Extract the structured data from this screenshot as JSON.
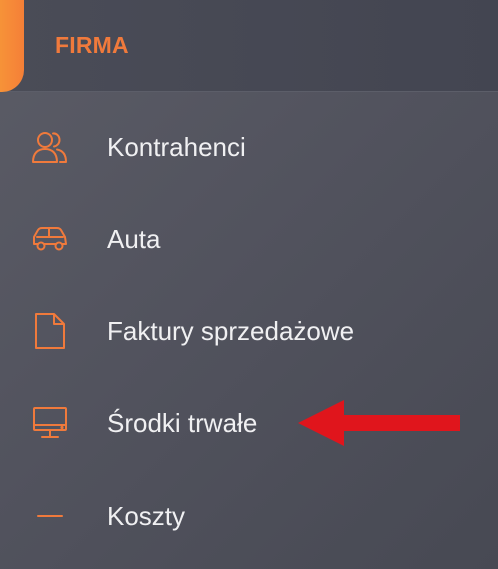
{
  "header": {
    "title": "FIRMA"
  },
  "menu": {
    "items": [
      {
        "label": "Kontrahenci",
        "icon": "users-icon"
      },
      {
        "label": "Auta",
        "icon": "car-icon"
      },
      {
        "label": "Faktury sprzedażowe",
        "icon": "document-icon"
      },
      {
        "label": "Środki trwałe",
        "icon": "monitor-icon"
      },
      {
        "label": "Koszty",
        "icon": "minus-icon"
      }
    ]
  },
  "colors": {
    "accent": "#f07a3c",
    "arrow": "#e0151c",
    "text": "#f0f0f2",
    "background": "#52535e"
  }
}
